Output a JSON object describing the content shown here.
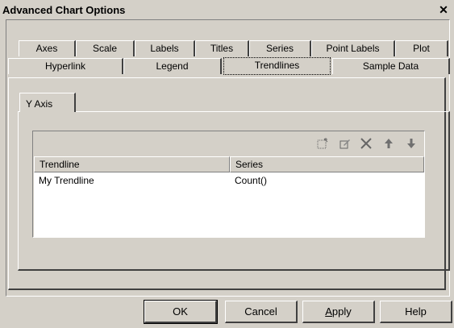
{
  "window": {
    "title": "Advanced Chart Options",
    "close_glyph": "✕"
  },
  "tabs_row1": [
    "Axes",
    "Scale",
    "Labels",
    "Titles",
    "Series",
    "Point Labels",
    "Plot"
  ],
  "tabs_row2": [
    "Hyperlink",
    "Legend",
    "Trendlines",
    "Sample Data"
  ],
  "active_tab": "Trendlines",
  "sub_tab": {
    "label": "Y Axis"
  },
  "toolbar": {
    "icons": [
      "new-trendline-icon",
      "edit-trendline-icon",
      "delete-icon",
      "move-up-icon",
      "move-down-icon"
    ]
  },
  "grid": {
    "columns": [
      "Trendline",
      "Series"
    ],
    "rows": [
      {
        "trendline": "My Trendline",
        "series": "Count()"
      }
    ]
  },
  "buttons": {
    "ok": "OK",
    "cancel": "Cancel",
    "apply": "Apply",
    "help": "Help"
  }
}
